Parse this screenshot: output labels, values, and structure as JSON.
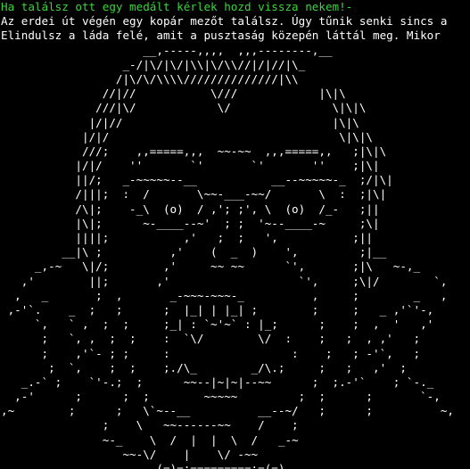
{
  "terminal": {
    "background_color": "#000000",
    "text_color": "#ffffff",
    "highlight_color": "#3cd43c",
    "header_line": "Ha találsz ott egy medált kérlek hozd vissza nekem!-",
    "story_lines": [
      "Az erdei út végén egy kopár mezőt találsz. Úgy tűnik senki sincs a",
      "Elindulsz a láda felé, amit a pusztaság közepén láttál meg. Mikor"
    ],
    "ascii_art": [
      "                     __,-----,,,,  ,,,--------,__",
      "                  _-/|\\/|\\/|\\\\|\\/\\\\//|/|//|\\_",
      "                 /|\\/\\/\\\\\\\\//////////////|\\\\",
      "               //|//           \\///            |\\|\\",
      "              ///|\\/            \\/               \\|\\|\\",
      "             |/|//                               |\\|\\",
      "            |/|/                                  \\|\\|\\",
      "            ///;    ,,=====,,,  ~~-~~  ,,,=====,,   ;|\\|\\",
      "           |/|/    ''       `'       `'       ''    ;|\\|",
      "           ||/;   _-~~~~~--__           __--~~~~~-_  ;/|\\|",
      "           /|||;  :  /       \\~~-___-~~/       \\  :  ;|\\|",
      "           /\\|;    -_\\  (o)  / ,'; ;', \\  (o)  /_-   ;||",
      "           |\\|;      ~-____--~'  ; ;  '~--____-~     ;\\|",
      "           ||||;           ,'   ;  ;   ',           ;||",
      "         __|\\ ;          ,'    (  _  )    ',         ;|__",
      "     _,-~   \\|/;        ,'     ~~ ~~      `',       ;|\\   ~-,_",
      "   ,'        ||;       ,'                   `',     ;\\|/        `,",
      "  ,   _       ;  ,       _-~~~-~~~-_          ,     ;        _   ,",
      " ,-'`.    _  ;   ;      ;  |_| | |_| ;        ;     ;   _ ,'`'-,",
      "     `,   ` ,  ;  ;     ;_| : `~'~` : |_;      ;    ;  ,  '   ,'",
      "      ;   `, ,  ;  ;    :  `\\/        \\/  :    ;   ;  , ,'   ;",
      "      ;    ,'`- ; ;     :                  :    ;   ; -'`,   ;",
      "       ;  `,    ;  ;    ;./\\_        _/\\.;     ;   ;   ,'  ;",
      "   _.-` ;    `'-.;  ;      ~~--|~|~|--~~      ;  ;.-'`    ; `-._",
      "  ,-'      ;      ;  ;        ~~~~~         ;  ;      ;       `-,",
      ",~        ;      ;   \\`~--__          __--~/   ;      ;          ~,",
      "               ;    \\   ~~------~~    /    ;",
      "               ~-_    \\  /  |  |  \\  /   _-~",
      "                  ~~-\\/    |    \\/ -~~",
      "                       (=)=;=========;=(=)"
    ]
  }
}
